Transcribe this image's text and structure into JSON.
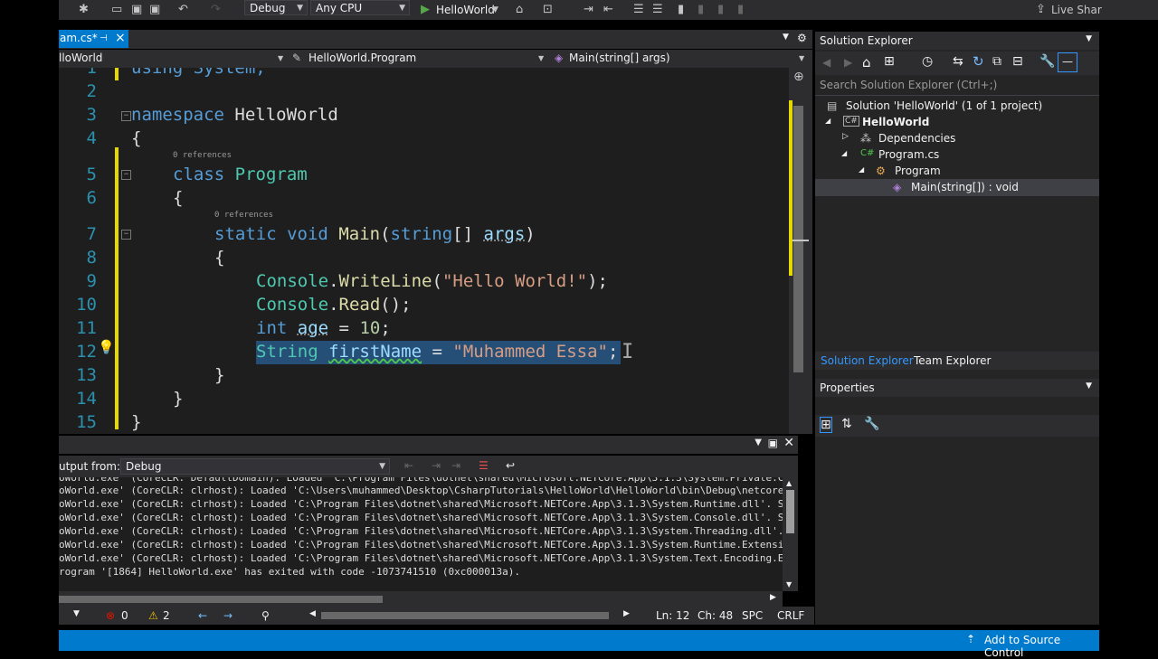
{
  "toolbar": {
    "config": "Debug",
    "platform": "Any CPU",
    "run_label": "HelloWorld",
    "live_share": "Live Shar"
  },
  "document": {
    "tab_label": "am.cs*",
    "pin": "⊣",
    "close": "×"
  },
  "navigation": {
    "project": "lloWorld",
    "class": "HelloWorld.Program",
    "member": "Main(string[] args)"
  },
  "editor": {
    "line_numbers": [
      "1",
      "2",
      "3",
      "4",
      "5",
      "6",
      "7",
      "8",
      "9",
      "10",
      "11",
      "12",
      "13",
      "14",
      "15"
    ],
    "codelens_class": "0 references",
    "codelens_method": "0 references",
    "lines": {
      "l1": "using System;",
      "l3_kw": "namespace",
      "l3_name": " HelloWorld",
      "l4": "{",
      "l5_kw": "class",
      "l5_name": "Program",
      "l6": "{",
      "l7_static": "static",
      "l7_void": "void",
      "l7_main": "Main",
      "l7_open": "(",
      "l7_string": "string",
      "l7_arr": "[] ",
      "l7_args": "args",
      "l7_close": ")",
      "l8": "{",
      "l9_console": "Console",
      "l9_dot": ".",
      "l9_method": "WriteLine",
      "l9_open": "(",
      "l9_str": "\"Hello World!\"",
      "l9_end": ");",
      "l10_console": "Console",
      "l10_dot": ".",
      "l10_method": "Read",
      "l10_end": "();",
      "l11_int": "int",
      "l11_var": "age",
      "l11_eq": " = ",
      "l11_num": "10",
      "l11_end": ";",
      "l12_type": "String",
      "l12_var": "firstName",
      "l12_eq": " = ",
      "l12_str": "\"Muhammed Essa\"",
      "l12_end": ";",
      "l13": "}",
      "l14": "}",
      "l15": "}"
    }
  },
  "output": {
    "show_from_label": "utput from:",
    "source": "Debug",
    "lines": [
      "oWorld.exe' (CoreCLR: DefaultDomain): Loaded 'C:\\Program Files\\dotnet\\shared\\Microsoft.NETCore.App\\3.1.3\\System.Private.Cor",
      "oWorld.exe' (CoreCLR: clrhost): Loaded 'C:\\Users\\muhammed\\Desktop\\CsharpTutorials\\HelloWorld\\HelloWorld\\bin\\Debug\\netcoreap",
      "oWorld.exe' (CoreCLR: clrhost): Loaded 'C:\\Program Files\\dotnet\\shared\\Microsoft.NETCore.App\\3.1.3\\System.Runtime.dll'. Ski",
      "oWorld.exe' (CoreCLR: clrhost): Loaded 'C:\\Program Files\\dotnet\\shared\\Microsoft.NETCore.App\\3.1.3\\System.Console.dll'. Ski",
      "oWorld.exe' (CoreCLR: clrhost): Loaded 'C:\\Program Files\\dotnet\\shared\\Microsoft.NETCore.App\\3.1.3\\System.Threading.dll'. S",
      "oWorld.exe' (CoreCLR: clrhost): Loaded 'C:\\Program Files\\dotnet\\shared\\Microsoft.NETCore.App\\3.1.3\\System.Runtime.Extension",
      "oWorld.exe' (CoreCLR: clrhost): Loaded 'C:\\Program Files\\dotnet\\shared\\Microsoft.NETCore.App\\3.1.3\\System.Text.Encoding.Ext",
      "rogram '[1864] HelloWorld.exe' has exited with code -1073741510 (0xc000013a)."
    ]
  },
  "status": {
    "errors": "0",
    "warnings": "2",
    "line": "Ln: 12",
    "col": "Ch: 48",
    "spc": "SPC",
    "crlf": "CRLF"
  },
  "solution_explorer": {
    "title": "Solution Explorer",
    "search_placeholder": "Search Solution Explorer (Ctrl+;)",
    "solution": "Solution 'HelloWorld' (1 of 1 project)",
    "project": "HelloWorld",
    "dependencies": "Dependencies",
    "file": "Program.cs",
    "class": "Program",
    "method": "Main(string[]) : void",
    "tab_solution": "Solution Explorer",
    "tab_team": "Team Explorer"
  },
  "properties": {
    "title": "Properties"
  },
  "bottom_bar": {
    "source_control": "Add to Source Control"
  }
}
